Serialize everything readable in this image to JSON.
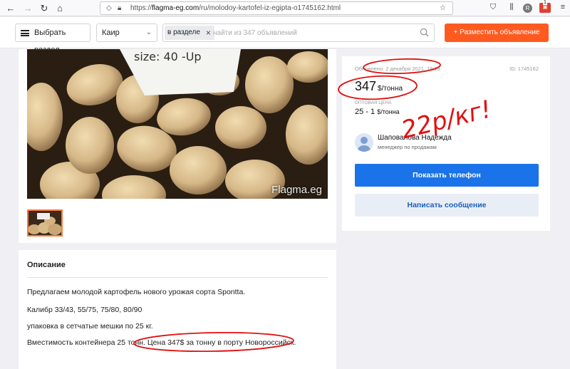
{
  "browser": {
    "url_prefix": "https://",
    "url_host": "flagma-eg.com",
    "url_path": "/ru/molodoy-kartofel-iz-egipta-o1745162.html",
    "badge_count": "1",
    "profile_letter": "R"
  },
  "header": {
    "section_button": "Выбрать раздел",
    "city": "Каир",
    "scope_chip": "в разделе",
    "search_placeholder": "найти из 347 объявлений",
    "post_button": "+ Разместить объявление"
  },
  "gallery": {
    "watermark": "Flagma.eg",
    "photo_label": "size: 40 -Up"
  },
  "description": {
    "title": "Описание",
    "lines": [
      "Предлагаем молодой картофель нового урожая сорта Spontta.",
      "Калибр 33/43, 55/75, 75/80, 80/90",
      "упаковка в сетчатые мешки по 25 кг.",
      "Вместимость контейнера 25 тонн. Цена 347$ за тонну в порту Новороссийск."
    ]
  },
  "offer": {
    "updated": "Обновлено: 2 декабря 2021, 19:29",
    "id": "ID: 1745162",
    "price": "347",
    "price_unit": "$/тонна",
    "wholesale_label": "Оптовая цена",
    "wholesale_range": "25 - 1",
    "wholesale_unit": "$/тонна",
    "seller_name": "Шаповалова Надежда",
    "seller_role": "менеджер по продажам",
    "phone_button": "Показать телефон",
    "message_button": "Написать сообщение"
  },
  "annotation": {
    "text": "22р/кг!",
    "color": "#e01010"
  },
  "colors": {
    "accent_orange": "#ff5a1f",
    "primary_blue": "#1a73e8"
  }
}
